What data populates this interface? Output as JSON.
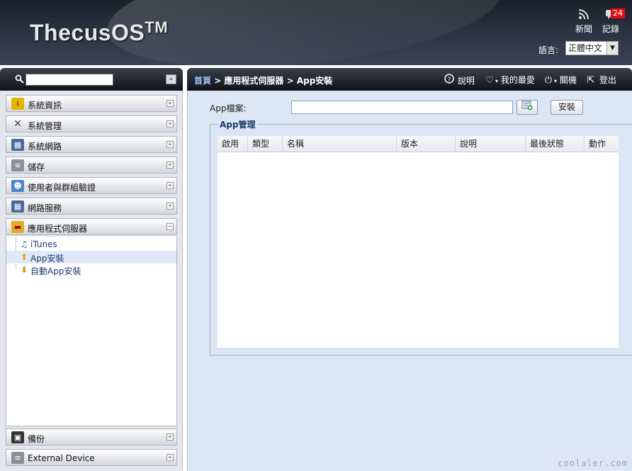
{
  "header": {
    "logo_text": "ThecusOS",
    "logo_sup": "TM",
    "news_label": "新聞",
    "log_label": "記錄",
    "log_badge": "24",
    "language_label": "語言:",
    "language_value": "正體中文"
  },
  "sidebar": {
    "search_placeholder": "",
    "items": [
      {
        "label": "系統資訊",
        "icon": "info-icon",
        "color": "#e8b400"
      },
      {
        "label": "系統管理",
        "icon": "tools-icon",
        "color": "#6a7080"
      },
      {
        "label": "系統網路",
        "icon": "network-icon",
        "color": "#4a6aa0"
      },
      {
        "label": "儲存",
        "icon": "storage-icon",
        "color": "#8a8f98"
      },
      {
        "label": "使用者與群組驗證",
        "icon": "users-icon",
        "color": "#4a86c8"
      },
      {
        "label": "網路服務",
        "icon": "network-service-icon",
        "color": "#4a6aa0"
      },
      {
        "label": "應用程式伺服器",
        "icon": "folder-icon",
        "color": "#e0b020"
      }
    ],
    "sub_items": [
      {
        "label": "iTunes",
        "icon": "music-note-icon"
      },
      {
        "label": "App安裝",
        "icon": "app-install-icon"
      },
      {
        "label": "自動App安裝",
        "icon": "auto-install-icon"
      }
    ],
    "bottom_items": [
      {
        "label": "備份",
        "icon": "backup-icon"
      },
      {
        "label": "External Device",
        "icon": "external-device-icon"
      }
    ]
  },
  "main": {
    "breadcrumb_home": "首頁",
    "breadcrumb_rest": " > 應用程式伺服器 > App安裝",
    "toolbar": {
      "help": "說明",
      "favorites": "我的最愛",
      "shutdown": "關機",
      "logout": "登出"
    },
    "app_file_label": "App檔案:",
    "app_file_value": "",
    "install_label": "安裝",
    "group_title": "App管理",
    "columns": [
      "啟用",
      "類型",
      "名稱",
      "版本",
      "說明",
      "最後狀態",
      "動作"
    ]
  },
  "watermark": "coolaler.com"
}
